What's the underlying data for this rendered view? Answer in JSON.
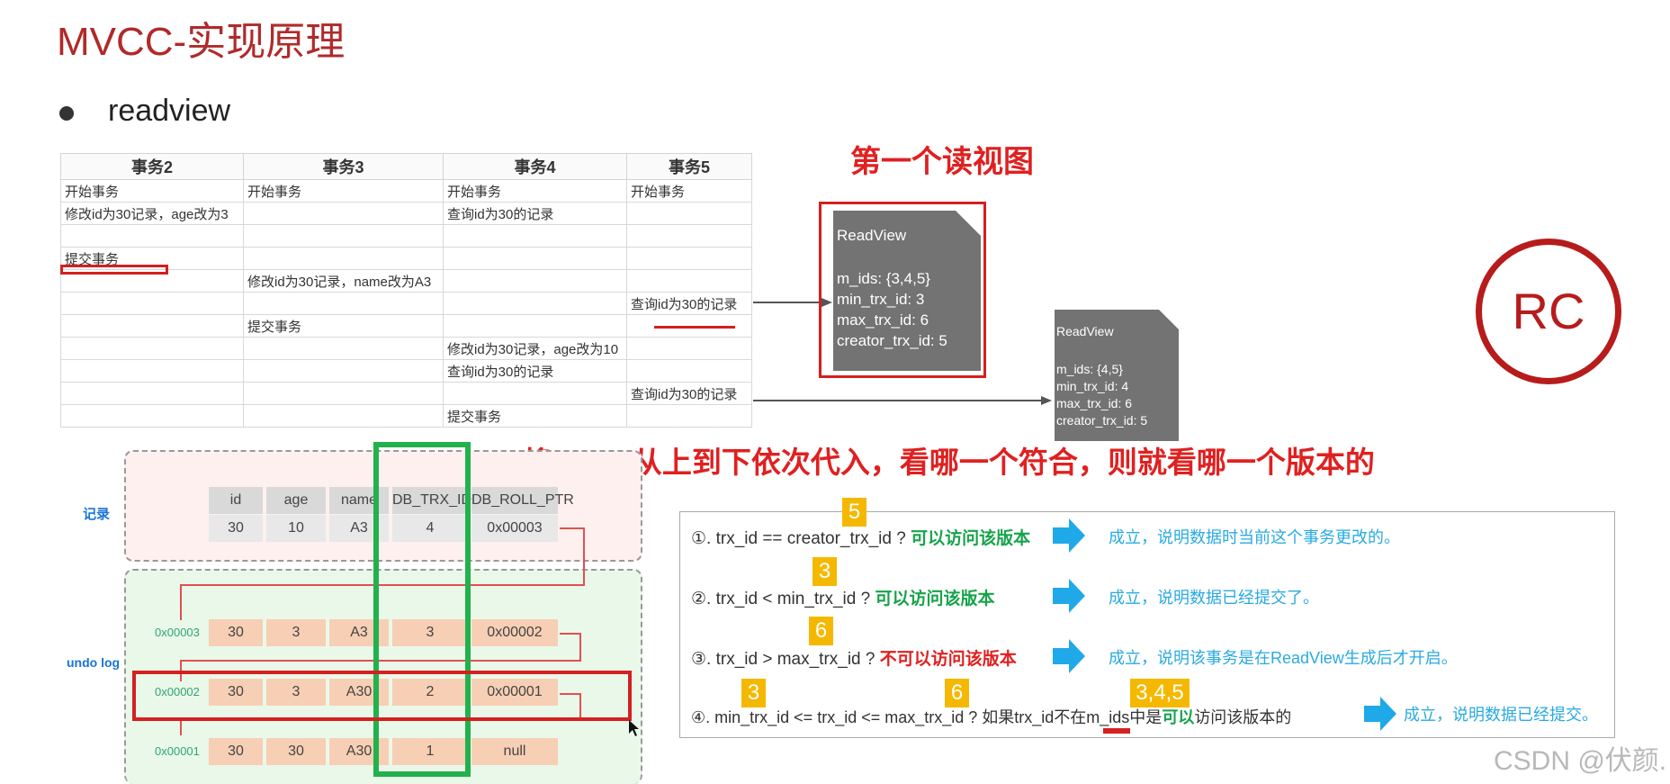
{
  "title": "MVCC-实现原理",
  "bullet": "readview",
  "tx_table": {
    "headers": [
      "事务2",
      "事务3",
      "事务4",
      "事务5"
    ],
    "rows": [
      [
        "开始事务",
        "开始事务",
        "开始事务",
        "开始事务"
      ],
      [
        "修改id为30记录，age改为3",
        "",
        "查询id为30的记录",
        ""
      ],
      [
        "",
        "",
        "",
        ""
      ],
      [
        "提交事务",
        "",
        "",
        ""
      ],
      [
        "",
        "修改id为30记录，name改为A3",
        "",
        ""
      ],
      [
        "",
        "",
        "",
        "查询id为30的记录"
      ],
      [
        "",
        "提交事务",
        "",
        ""
      ],
      [
        "",
        "",
        "修改id为30记录，age改为10",
        ""
      ],
      [
        "",
        "",
        "查询id为30的记录",
        ""
      ],
      [
        "",
        "",
        "",
        "查询id为30的记录"
      ],
      [
        "",
        "",
        "提交事务",
        ""
      ]
    ]
  },
  "first_view_title": "第一个读视图",
  "readview1": {
    "name": "ReadView",
    "m_ids": "m_ids: {3,4,5}",
    "min_trx_id": "min_trx_id: 3",
    "max_trx_id": "max_trx_id: 6",
    "creator_trx_id": "creator_trx_id: 5"
  },
  "readview2": {
    "name": "ReadView",
    "m_ids": "m_ids: {4,5}",
    "min_trx_id": "min_trx_id: 4",
    "max_trx_id": "max_trx_id: 6",
    "creator_trx_id": "creator_trx_id: 5"
  },
  "rc_label": "RC",
  "hint": "将trx_id从上到下依次代入，看哪一个符合，则就看哪一个版本的",
  "record": {
    "side_label": "记录",
    "headers": [
      "id",
      "age",
      "name",
      "DB_TRX_ID",
      "DB_ROLL_PTR"
    ],
    "values": [
      "30",
      "10",
      "A3",
      "4",
      "0x00003"
    ]
  },
  "undo_log": {
    "side_label": "undo log",
    "rows": [
      {
        "addr": "0x00003",
        "values": [
          "30",
          "3",
          "A3",
          "3",
          "0x00002"
        ]
      },
      {
        "addr": "0x00002",
        "values": [
          "30",
          "3",
          "A30",
          "2",
          "0x00001"
        ]
      },
      {
        "addr": "0x00001",
        "values": [
          "30",
          "30",
          "A30",
          "1",
          "null"
        ]
      }
    ]
  },
  "rules": [
    {
      "text": "①. trx_id  == creator_trx_id ?",
      "verdict": "可以访问该版本",
      "result": "成立，说明数据时当前这个事务更改的。",
      "tag": "5"
    },
    {
      "text": "②. trx_id < min_trx_id ?",
      "verdict": "可以访问该版本",
      "result": "成立，说明数据已经提交了。",
      "tag": "3"
    },
    {
      "text": "③. trx_id > max_trx_id ?",
      "verdict": "不可以访问该版本",
      "result": "成立，说明该事务是在ReadView生成后才开启。",
      "tag": "6"
    },
    {
      "text_a": "④. min_trx_id <= trx_id <= max_trx_id ? 如果trx_id",
      "text_neg": "不在",
      "text_b": "m_ids中是",
      "text_ok": "可以",
      "text_c": "访问该版本的",
      "result": "成立，说明数据已经提交。",
      "tag_a": "3",
      "tag_b": "6",
      "tag_c": "3,4,5"
    }
  ],
  "watermark": "CSDN @伏颜.",
  "colors": {
    "accent_red": "#d42020",
    "title_red": "#b02a2a",
    "green_box": "#22b14c",
    "tag_yellow": "#f5b800",
    "result_blue": "#2aaae0"
  }
}
